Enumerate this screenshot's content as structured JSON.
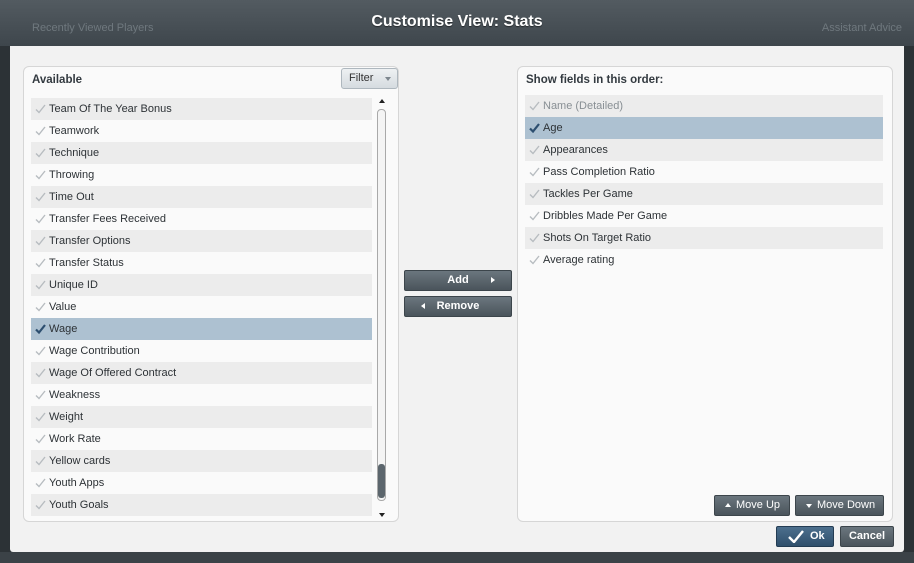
{
  "background": {
    "left_text": "Recently Viewed Players",
    "right_text": "Assistant Advice"
  },
  "dialog": {
    "title": "Customise View: Stats"
  },
  "available": {
    "header": "Available",
    "filter_label": "Filter",
    "items": [
      {
        "label": "Team Of The Year Bonus",
        "selected": false
      },
      {
        "label": "Teamwork",
        "selected": false
      },
      {
        "label": "Technique",
        "selected": false
      },
      {
        "label": "Throwing",
        "selected": false
      },
      {
        "label": "Time Out",
        "selected": false
      },
      {
        "label": "Transfer Fees Received",
        "selected": false
      },
      {
        "label": "Transfer Options",
        "selected": false
      },
      {
        "label": "Transfer Status",
        "selected": false
      },
      {
        "label": "Unique ID",
        "selected": false
      },
      {
        "label": "Value",
        "selected": false
      },
      {
        "label": "Wage",
        "selected": true
      },
      {
        "label": "Wage Contribution",
        "selected": false
      },
      {
        "label": "Wage Of Offered Contract",
        "selected": false
      },
      {
        "label": "Weakness",
        "selected": false
      },
      {
        "label": "Weight",
        "selected": false
      },
      {
        "label": "Work Rate",
        "selected": false
      },
      {
        "label": "Yellow cards",
        "selected": false
      },
      {
        "label": "Youth Apps",
        "selected": false
      },
      {
        "label": "Youth Goals",
        "selected": false
      }
    ]
  },
  "middle": {
    "add_label": "Add",
    "remove_label": "Remove"
  },
  "order": {
    "header": "Show fields in this order:",
    "items": [
      {
        "label": "Name (Detailed)",
        "selected": false,
        "locked": true
      },
      {
        "label": "Age",
        "selected": true,
        "locked": false
      },
      {
        "label": "Appearances",
        "selected": false,
        "locked": false
      },
      {
        "label": "Pass Completion Ratio",
        "selected": false,
        "locked": false
      },
      {
        "label": "Tackles Per Game",
        "selected": false,
        "locked": false
      },
      {
        "label": "Dribbles Made Per Game",
        "selected": false,
        "locked": false
      },
      {
        "label": "Shots On Target Ratio",
        "selected": false,
        "locked": false
      },
      {
        "label": "Average rating",
        "selected": false,
        "locked": false
      }
    ],
    "move_up_label": "Move Up",
    "move_down_label": "Move Down"
  },
  "footer": {
    "ok_label": "Ok",
    "cancel_label": "Cancel"
  },
  "colors": {
    "selected_row": "#adc1d1",
    "check_active": "#2d4f70",
    "check_inactive": "#b7bcc0"
  }
}
